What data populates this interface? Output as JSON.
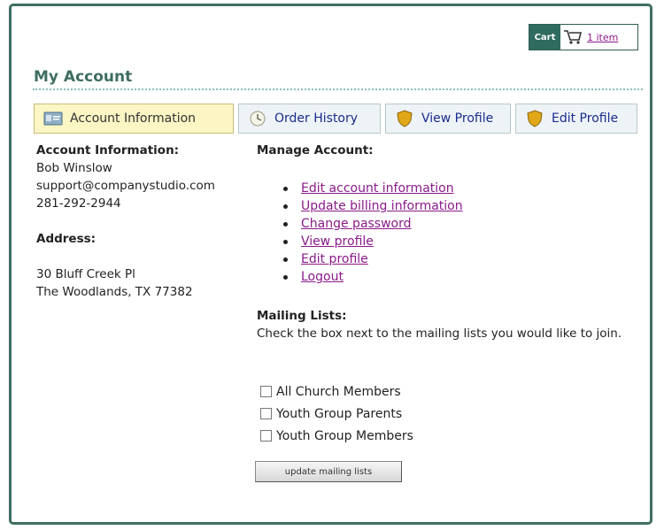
{
  "cart": {
    "label": "Cart",
    "link": "1 item"
  },
  "page": {
    "title": "My Account"
  },
  "tabs": [
    {
      "label": "Account Information",
      "active": true,
      "icon": "id-card-icon"
    },
    {
      "label": "Order History",
      "active": false,
      "icon": "clock-icon"
    },
    {
      "label": "View Profile",
      "active": false,
      "icon": "shield-icon"
    },
    {
      "label": "Edit Profile",
      "active": false,
      "icon": "shield-icon"
    }
  ],
  "account": {
    "heading": "Account Information:",
    "name": "Bob Winslow",
    "email": "support@companystudio.com",
    "phone": "281-292-2944"
  },
  "address": {
    "heading": "Address:",
    "line1": "30 Bluff Creek Pl",
    "line2": "The Woodlands, TX 77382"
  },
  "manage": {
    "heading": "Manage Account:",
    "links": [
      "Edit account information",
      "Update billing information",
      "Change password",
      "View profile",
      "Edit profile",
      "Logout"
    ]
  },
  "mailing": {
    "heading": "Mailing Lists:",
    "description": "Check the box next to the mailing lists you would like to join.",
    "lists": [
      {
        "label": "All Church Members",
        "checked": false
      },
      {
        "label": "Youth Group Parents",
        "checked": false
      },
      {
        "label": "Youth Group Members",
        "checked": false
      }
    ],
    "button": "update mailing lists"
  },
  "colors": {
    "frame": "#3f6e62",
    "title": "#3f6e62",
    "link": "#8a1a8a",
    "tab_text": "#1a2c8c",
    "active_tab_bg": "#fbf6c4"
  }
}
